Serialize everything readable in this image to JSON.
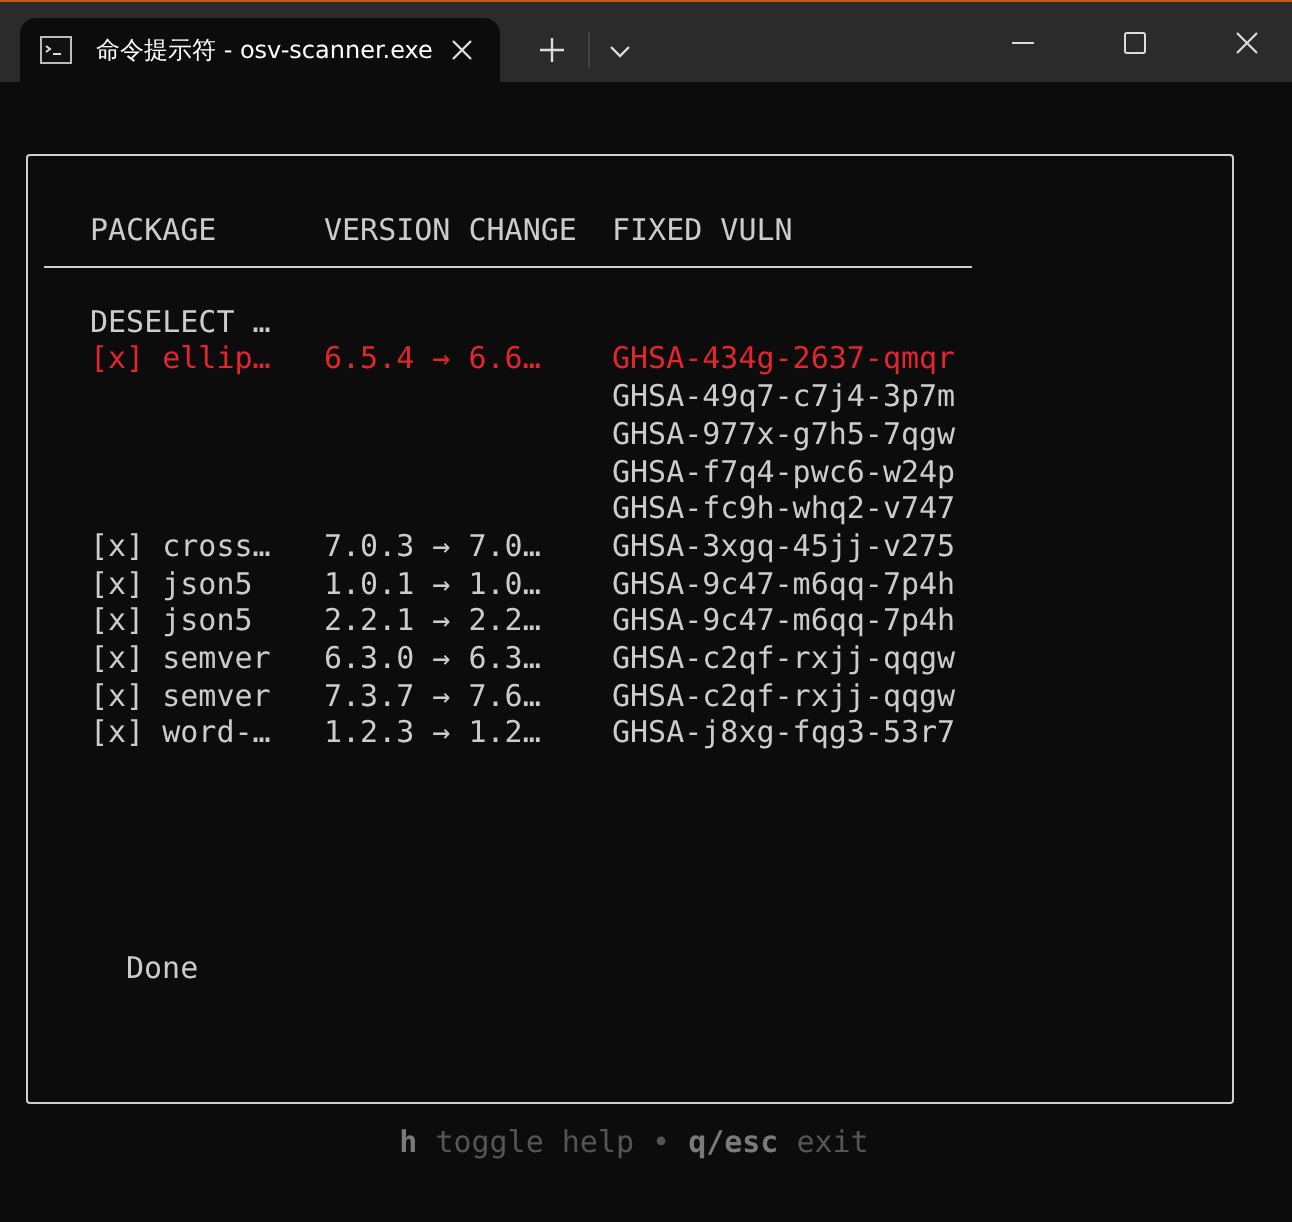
{
  "window": {
    "tab_title": "命令提示符 - osv-scanner.exe"
  },
  "table": {
    "columns": [
      "PACKAGE",
      "VERSION CHANGE",
      "FIXED VULN"
    ],
    "deselect": "DESELECT …",
    "rows": [
      {
        "checkbox": "[x]",
        "package": "ellip…",
        "change": "6.5.4 → 6.6…",
        "vulns": [
          "GHSA-434g-2637-qmqr",
          "GHSA-49q7-c7j4-3p7m",
          "GHSA-977x-g7h5-7qgw",
          "GHSA-f7q4-pwc6-w24p",
          "GHSA-fc9h-whq2-v747"
        ],
        "selected": true
      },
      {
        "checkbox": "[x]",
        "package": "cross…",
        "change": "7.0.3 → 7.0…",
        "vulns": [
          "GHSA-3xgq-45jj-v275"
        ],
        "selected": false
      },
      {
        "checkbox": "[x]",
        "package": "json5",
        "change": "1.0.1 → 1.0…",
        "vulns": [
          "GHSA-9c47-m6qq-7p4h"
        ],
        "selected": false
      },
      {
        "checkbox": "[x]",
        "package": "json5",
        "change": "2.2.1 → 2.2…",
        "vulns": [
          "GHSA-9c47-m6qq-7p4h"
        ],
        "selected": false
      },
      {
        "checkbox": "[x]",
        "package": "semver",
        "change": "6.3.0 → 6.3…",
        "vulns": [
          "GHSA-c2qf-rxjj-qqgw"
        ],
        "selected": false
      },
      {
        "checkbox": "[x]",
        "package": "semver",
        "change": "7.3.7 → 7.6…",
        "vulns": [
          "GHSA-c2qf-rxjj-qqgw"
        ],
        "selected": false
      },
      {
        "checkbox": "[x]",
        "package": "word-…",
        "change": "1.2.3 → 1.2…",
        "vulns": [
          "GHSA-j8xg-fqg3-53r7"
        ],
        "selected": false
      }
    ]
  },
  "status": "Done",
  "help": {
    "items": [
      {
        "key": "h",
        "desc": "toggle help"
      },
      {
        "key": "q/esc",
        "desc": "exit"
      }
    ],
    "separator": "•"
  }
}
